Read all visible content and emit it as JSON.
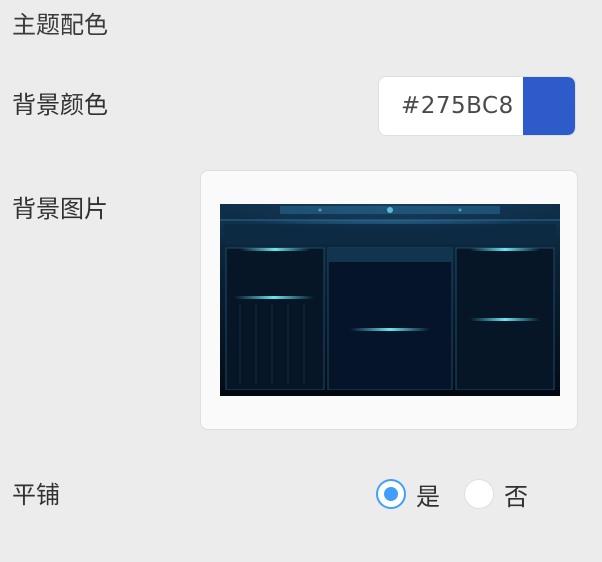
{
  "section": {
    "title": "主题配色"
  },
  "background_color": {
    "label": "背景颜色",
    "value": "#275BC8",
    "swatch_color": "#2d5bc9"
  },
  "background_image": {
    "label": "背景图片",
    "preview_icon": "dashboard-preview-image"
  },
  "tile": {
    "label": "平铺",
    "options": [
      {
        "label": "是",
        "checked": true
      },
      {
        "label": "否",
        "checked": false
      }
    ],
    "accent_color": "#409eff"
  }
}
